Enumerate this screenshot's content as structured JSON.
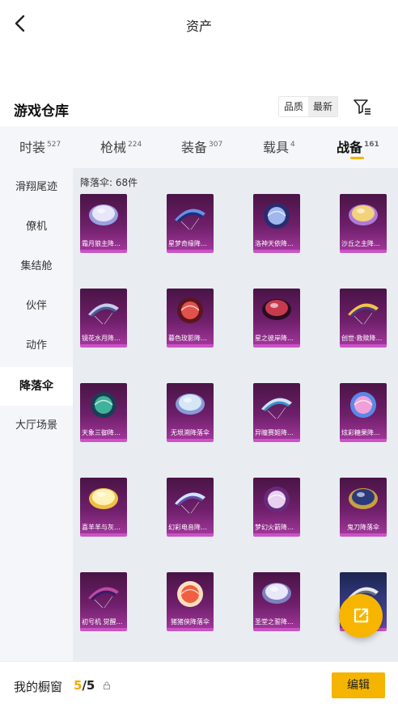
{
  "header": {
    "title": "资产",
    "back_icon": "chevron-left-icon"
  },
  "section": {
    "title": "游戏仓库",
    "sort_options": [
      "品质",
      "最新"
    ],
    "active_sort": "最新",
    "filter_icon": "filter-icon"
  },
  "tabs": [
    {
      "label": "时装",
      "count": "527"
    },
    {
      "label": "枪械",
      "count": "224"
    },
    {
      "label": "装备",
      "count": "307"
    },
    {
      "label": "载具",
      "count": "4"
    },
    {
      "label": "战备",
      "count": "161",
      "active": true
    }
  ],
  "sidebar": [
    {
      "label": "滑翔尾迹"
    },
    {
      "label": "僚机"
    },
    {
      "label": "集结舱"
    },
    {
      "label": "伙伴"
    },
    {
      "label": "动作"
    },
    {
      "label": "降落伞",
      "active": true
    },
    {
      "label": "大厅场景"
    }
  ],
  "content": {
    "count_label": "降落伞: 68件",
    "items": [
      {
        "name": "霜月狼主降落伞"
      },
      {
        "name": "星梦奇缘降落伞"
      },
      {
        "name": "洛神天依降落伞"
      },
      {
        "name": "沙丘之主降落伞"
      },
      {
        "name": "镜花水月降落伞"
      },
      {
        "name": "暮色玫影降落伞"
      },
      {
        "name": "星之彼岸降落伞"
      },
      {
        "name": "创世·救赎降落伞"
      },
      {
        "name": "天象三御降落伞"
      },
      {
        "name": "无垠溯降落伞"
      },
      {
        "name": "异瞳赛姬降落伞"
      },
      {
        "name": "炫彩糖果降落伞"
      },
      {
        "name": "喜羊羊与灰太狼降落伞"
      },
      {
        "name": "幻彩电音降落伞"
      },
      {
        "name": "梦幻火箭降落伞"
      },
      {
        "name": "鬼刀降落伞"
      },
      {
        "name": "初号机 觉醒V降落伞"
      },
      {
        "name": "猪猪侠降落伞"
      },
      {
        "name": "圣堂之誓降落伞"
      },
      {
        "name": ""
      }
    ]
  },
  "fab_icon": "share-external-icon",
  "bottom": {
    "label": "我的橱窗",
    "current": "5",
    "total": "/5",
    "lock_icon": "lock-icon",
    "edit_label": "编辑"
  },
  "colors": {
    "accent": "#f5b400",
    "card_purple": "#6e1f6a"
  }
}
